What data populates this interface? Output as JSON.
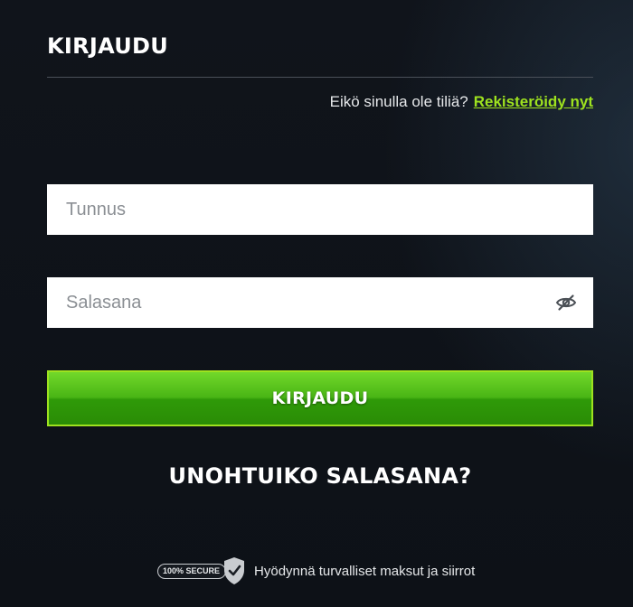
{
  "login": {
    "title": "KIRJAUDU",
    "no_account_text": "Eikö sinulla ole tiliä?",
    "register_link": "Rekisteröidy nyt",
    "username": {
      "value": "",
      "placeholder": "Tunnus"
    },
    "password": {
      "value": "",
      "placeholder": "Salasana",
      "toggle_icon": "eye-slash-icon"
    },
    "submit_label": "KIRJAUDU",
    "forgot_password": "UNOHTUIKO SALASANA?"
  },
  "secure": {
    "badge_text": "100% SECURE",
    "badge_icon": "shield-check-icon",
    "text": "Hyödynnä turvalliset maksut ja siirrot"
  },
  "colors": {
    "background": "#0f1218",
    "accent_link": "#9ee21f",
    "button_green": "#49b515",
    "button_border": "#9ee21f"
  }
}
